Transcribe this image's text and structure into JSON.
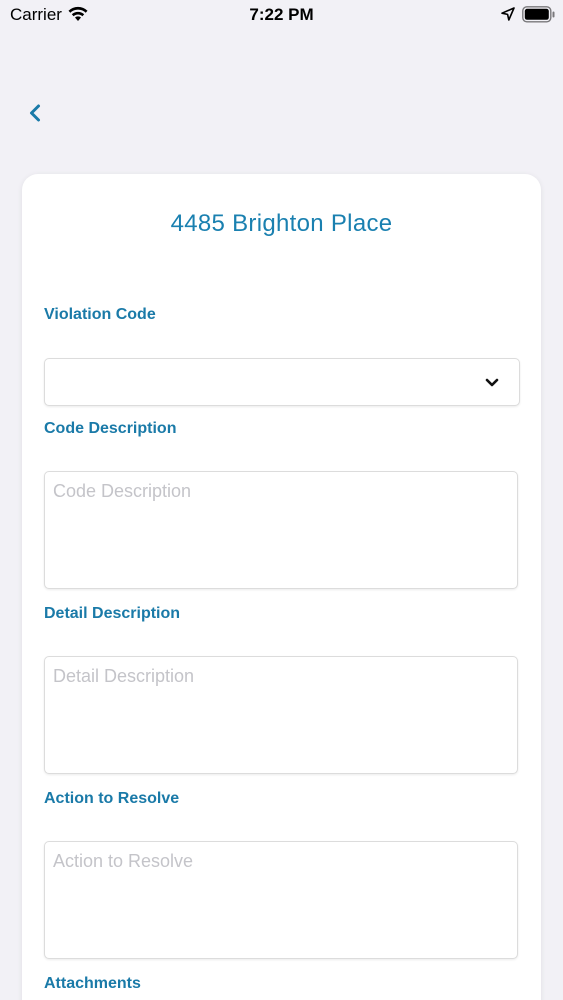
{
  "status_bar": {
    "carrier": "Carrier",
    "time": "7:22 PM",
    "icons": [
      "wifi-icon",
      "location-arrow-icon",
      "battery-icon"
    ]
  },
  "nav": {
    "back_icon": "chevron-left-icon"
  },
  "form": {
    "title": "4485 Brighton Place",
    "violation_code": {
      "label": "Violation Code",
      "value": ""
    },
    "code_description": {
      "label": "Code Description",
      "placeholder": "Code Description",
      "value": ""
    },
    "detail_description": {
      "label": "Detail Description",
      "placeholder": "Detail Description",
      "value": ""
    },
    "action_to_resolve": {
      "label": "Action to Resolve",
      "placeholder": "Action to Resolve",
      "value": ""
    },
    "attachments": {
      "label": "Attachments"
    }
  },
  "colors": {
    "accent": "#1a7aa8",
    "background": "#f2f1f6",
    "card": "#ffffff",
    "placeholder": "#c4c4c9"
  }
}
